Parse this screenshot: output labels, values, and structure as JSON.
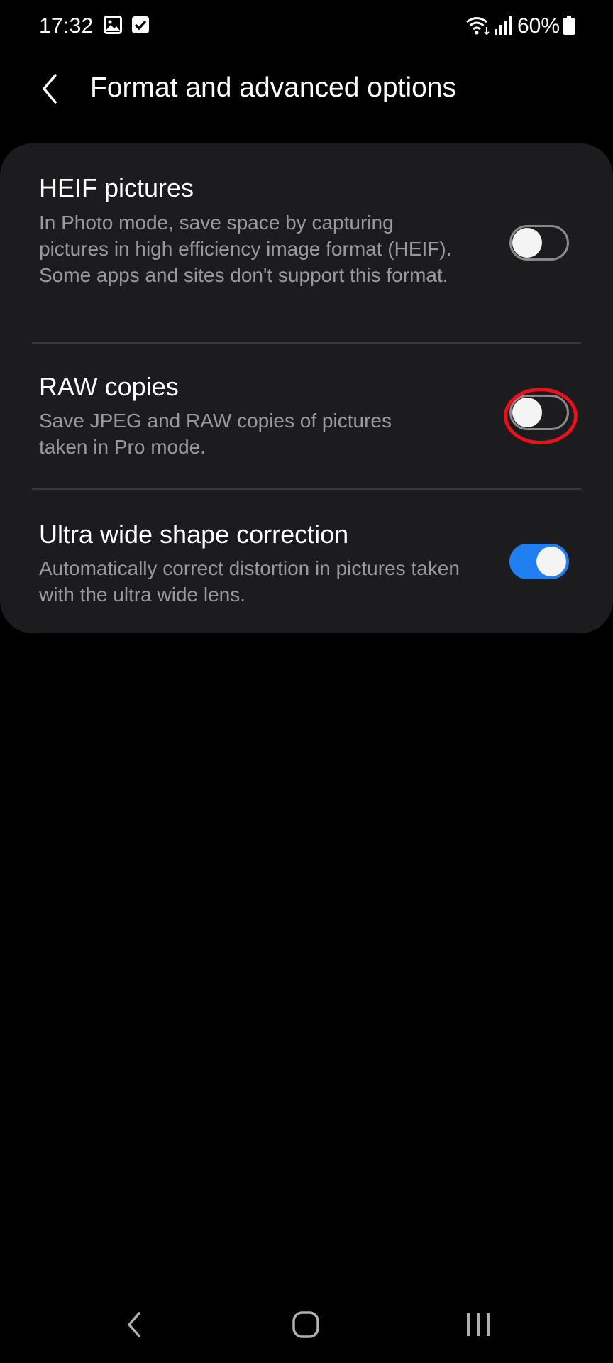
{
  "status_bar": {
    "time": "17:32",
    "battery_percent": "60%",
    "icons": [
      "gallery-icon",
      "checkbox-icon",
      "wifi-icon",
      "signal-icon",
      "battery-icon"
    ]
  },
  "header": {
    "title": "Format and advanced options",
    "back_icon": "chevron-left-icon"
  },
  "settings": [
    {
      "title": "HEIF pictures",
      "description": "In Photo mode, save space by capturing pictures in high efficiency image format (HEIF). Some apps and sites don't support this format.",
      "enabled": false
    },
    {
      "title": "RAW copies",
      "description": "Save JPEG and RAW copies of pictures taken in Pro mode.",
      "enabled": false,
      "highlighted": true
    },
    {
      "title": "Ultra wide shape correction",
      "description": "Automatically correct distortion in pictures taken with the ultra wide lens.",
      "enabled": true
    }
  ],
  "colors": {
    "background": "#000000",
    "card": "#1c1c1e",
    "toggle_on": "#1f7ff0",
    "highlight": "#e8101c",
    "description_text": "#9a9a9a"
  },
  "nav_bar": {
    "buttons": [
      "back-nav-icon",
      "home-nav-icon",
      "recents-nav-icon"
    ]
  }
}
